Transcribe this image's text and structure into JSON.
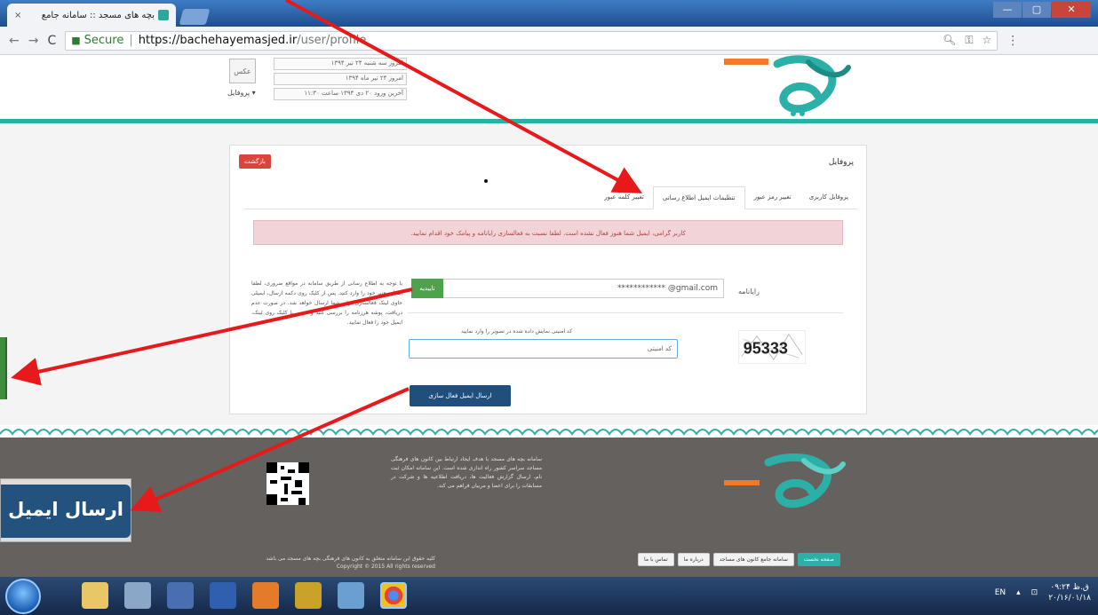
{
  "browser": {
    "tab_title": "بچه های مسجد :: سامانه جامع",
    "tab_close": "×",
    "secure_label": "Secure",
    "url_host": "https://bachehayemasjed.ir",
    "url_path": "/user/profile",
    "window_controls": [
      "—",
      "▢",
      "✕"
    ]
  },
  "header": {
    "avatar_text": "عکس",
    "profile_menu": "پروفایل ▾",
    "profile_lines": [
      "امروز سه شنبه ۲۴ تیر ۱۳۹۴",
      "امروز ۲۴ تیر ماه ۱۳۹۴",
      "آخرین ورود ۲۰ دی ۱۳۹۴ ساعت ۱۱:۳۰"
    ]
  },
  "card": {
    "title": "پروفایل",
    "return_label": "بازگشت",
    "tabs": [
      "پروفایل کاربری",
      "تغییر رمز عبور",
      "تنظیمات ایمیل اطلاع رسانی",
      "تغییر کلمه عبور"
    ],
    "active_tab": 2,
    "alert": "کاربر گرامی، ایمیل شما هنوز فعال نشده است. لطفا نسبت به فعالسازی رایانامه و پیامک خود اقدام نمایید.",
    "email_label": "رایانامه",
    "email_value": "************ @gmail.com",
    "confirm_label": "تاییدیه",
    "help_text": "با توجه به اطلاع رسانی از طریق سامانه در مواقع ضروری، لطفا ایمیل معتبر خود را وارد کنید. پس از کلیک روی دکمه ارسال، ایمیلی حاوی لینک فعالسازی برای شما ارسال خواهد شد. در صورت عدم دریافت، پوشه هرزنامه را بررسی کنید و سپس با کلیک روی لینک، ایمیل خود را فعال نمایید.",
    "captcha_hint": "کد امنیتی نمایش داده شده در تصویر را وارد نمایید",
    "captcha_placeholder": "کد امنیتی",
    "captcha_code": "95333",
    "send_label": "ارسال ایمیل فعال سازی"
  },
  "footer": {
    "about": "سامانه بچه های مسجد با هدف ایجاد ارتباط بین کانون های فرهنگی مساجد سراسر کشور راه اندازی شده است. این سامانه امکان ثبت نام، ارسال گزارش فعالیت ها، دریافت اطلاعیه ها و شرکت در مسابقات را برای اعضا و مربیان فراهم می کند.",
    "copyright": "کلیه حقوق این سامانه متعلق به کانون های فرهنگی بچه های مسجد می باشد\nCopyright © 2015 All rights reserved",
    "links": [
      "صفحه نخست",
      "سامانه جامع کانون های مساجد",
      "درباره ما",
      "تماس با ما"
    ]
  },
  "callout": {
    "button_text": "ارسال ایمیل"
  },
  "taskbar": {
    "language": "EN",
    "time": "۰۹:۲۴ ق.ظ",
    "date": "۲۰/۱۶/۰۱/۱۸"
  },
  "colors": {
    "teal": "#2bb0a8",
    "navy_button": "#1f4f7a",
    "green_button": "#4ca34c",
    "red_button": "#d9453a",
    "alert_bg": "#f2d4d8",
    "annotation_arrow": "#e8191b"
  }
}
